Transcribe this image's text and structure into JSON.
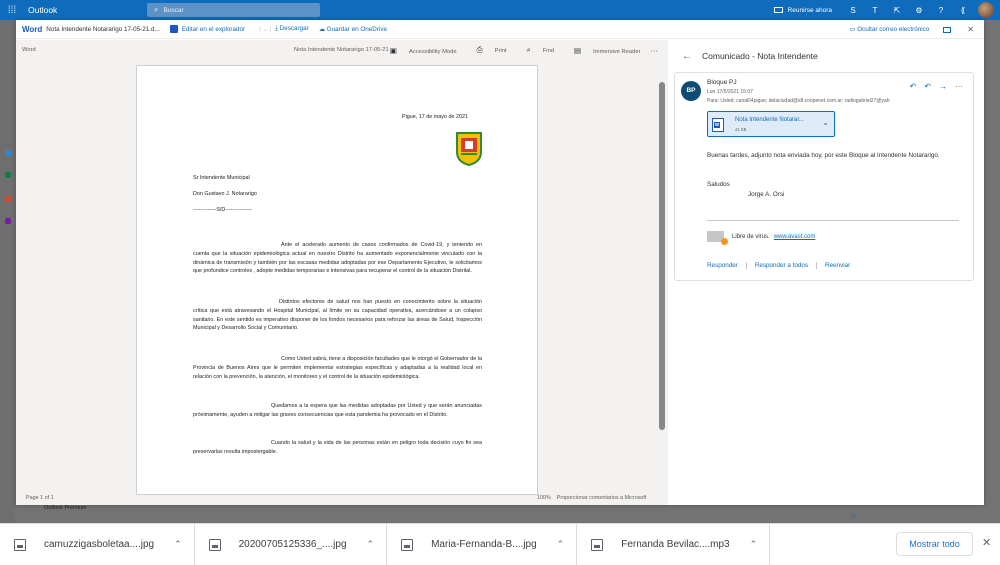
{
  "app": {
    "name": "Outlook",
    "search_placeholder": "Buscar",
    "meet_now": "Reunirse ahora"
  },
  "viewer": {
    "word_label": "Word",
    "file_name": "Nota Intendente Notararigo 17-05-21.d...",
    "edit_in_browser": "Editar en el explorador",
    "download": "Descargar",
    "save_onedrive": "Guardar en OneDrive",
    "hide_email": "Ocultar correo electrónico"
  },
  "doc_pane": {
    "app_label": "Word",
    "doc_name": "Nota Intendente Notararigo 17-05-21",
    "accessibility": "Accessibility Mode",
    "print": "Print",
    "find": "Find",
    "immersive": "Immersive Reader",
    "more": "···",
    "page_info": "Page 1 of 1",
    "zoom": "100%",
    "feedback": "Proporcionar comentarios a Microsoft"
  },
  "letter": {
    "date": "Pigue, 17 de mayo de 2021",
    "to1": "Sr Intendente Municipal",
    "to2": "Don Gustavo J. Notararigo",
    "to3": "-------------S/D---------------",
    "p1": "Ante el acelerado aumento de casos confirmados de Covid-19, y teniendo en cuenta que la situación epidemiológica actual en nuestro Distrito ha aumentado exponencialmente vinculado con la dinámica de transmisión y también por las escasas medidas adoptadas por ese Departamento Ejecutivo, le solicitamos que profundice controles , adopte medidas temporarias e intensivas para recuperar el control de la situación Distrital.",
    "p2": "Distintos efectores de salud nos han puesto en conocimiento sobre la situación crítica que está atravesando el Hospital Municipal, al límite en su capacidad operativa, acercándose a un colapso sanitario. En este sentido es imperativo disponer de los fondos necesarios para reforzar las áreas de Salud, Inspección Municipal y Desarrollo Social y Comunitario.",
    "p3": "Como Usted sabrá, tiene a disposición facultades que le otorgó el Gobernador de la Provincia de Buenos Aires que le permiten implementar estrategias específicas y adaptadas a la realidad local en relación con la prevención, la atención, el monitoreo y el control de la situación epidemiológica.",
    "p4": "Quedamos a la espera que las medidas adoptadas por Usted y que serán anunciadas próximamente, ayuden a mitigar las graves consecuencias que esta pandemia ha provocado en el Distrito.",
    "p5": "Cuando la salud y la vida de las personas están en peligro toda decisión cuyo fin sea preservarlas resulta impostergable."
  },
  "email": {
    "subject": "Comunicado - Nota Intendente",
    "avatar": "BP",
    "sender": "Bloque PJ",
    "date": "Lun 17/5/2021 15:07",
    "to": "Para: Usted; canal04pigue; delaciudad@s8.coopenet.com.ar; radiogabriel27@yah",
    "attachment_name": "Nota Intendente Notarar...",
    "attachment_size": "41 KB",
    "body1": "Buenas tardes, adjunto nota enviada hoy, por este Bloque al Intendente Notararigo.",
    "body2": "Saludos",
    "body3": "Jorge A. Orsi",
    "virus_text": "Libre de virus.",
    "virus_link": "www.avast.com",
    "reply": "Responder",
    "reply_all": "Responder a todos",
    "forward": "Reenviar"
  },
  "background_text": "Outlook Premium",
  "downloads": {
    "items": [
      "camuzzigasboletaa....jpg",
      "20200705125336_....jpg",
      "Maria-Fernanda-B....jpg",
      "Fernanda Bevilac....mp3"
    ],
    "show_all": "Mostrar todo"
  },
  "colors": {
    "outlook_blue": "#0f6cbd",
    "word_blue": "#185abd"
  }
}
